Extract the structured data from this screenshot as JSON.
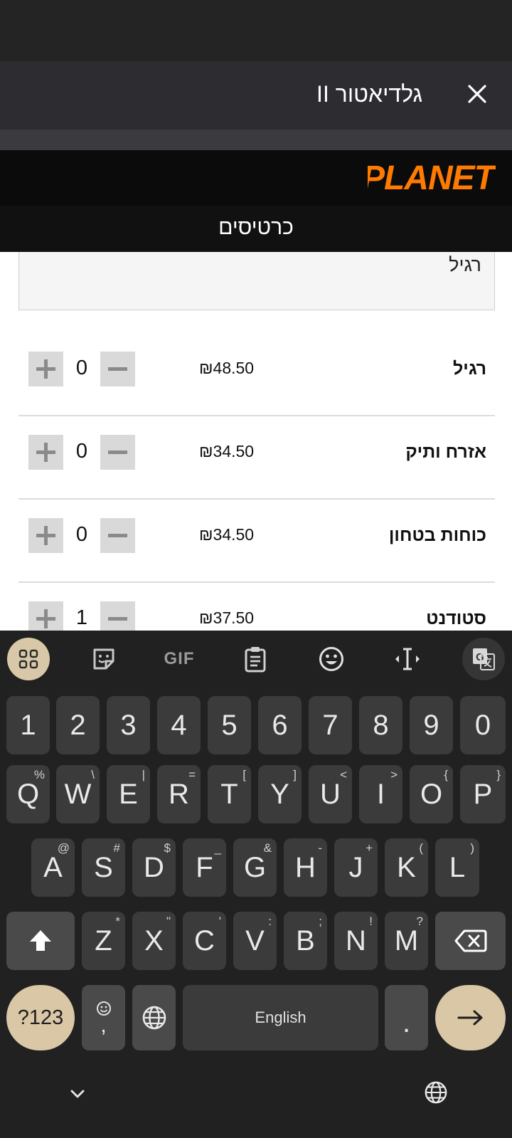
{
  "app_bar": {
    "title": "גלדיאטור II"
  },
  "brand": {
    "logo_text": "PLANET",
    "logo_color": "#ff7a00"
  },
  "section": {
    "title": "כרטיסים"
  },
  "ticket_type_select": {
    "value": "רגיל"
  },
  "tickets": [
    {
      "name": "רגיל",
      "price": "₪48.50",
      "qty": "0"
    },
    {
      "name": "אזרח ותיק",
      "price": "₪34.50",
      "qty": "0"
    },
    {
      "name": "כוחות בטחון",
      "price": "₪34.50",
      "qty": "0"
    },
    {
      "name": "סטודנט",
      "price": "₪37.50",
      "qty": "1"
    }
  ],
  "keyboard": {
    "toolbar": [
      "apps",
      "sticker",
      "GIF",
      "clipboard",
      "emoji",
      "text-cursor",
      "translate"
    ],
    "gif_label": "GIF",
    "number_row": [
      "1",
      "2",
      "3",
      "4",
      "5",
      "6",
      "7",
      "8",
      "9",
      "0"
    ],
    "row1": [
      {
        "key": "Q",
        "hint": "%"
      },
      {
        "key": "W",
        "hint": "\\"
      },
      {
        "key": "E",
        "hint": "|"
      },
      {
        "key": "R",
        "hint": "="
      },
      {
        "key": "T",
        "hint": "["
      },
      {
        "key": "Y",
        "hint": "]"
      },
      {
        "key": "U",
        "hint": "<"
      },
      {
        "key": "I",
        "hint": ">"
      },
      {
        "key": "O",
        "hint": "{"
      },
      {
        "key": "P",
        "hint": "}"
      }
    ],
    "row2": [
      {
        "key": "A",
        "hint": "@"
      },
      {
        "key": "S",
        "hint": "#"
      },
      {
        "key": "D",
        "hint": "$"
      },
      {
        "key": "F",
        "hint": "_"
      },
      {
        "key": "G",
        "hint": "&"
      },
      {
        "key": "H",
        "hint": "-"
      },
      {
        "key": "J",
        "hint": "+"
      },
      {
        "key": "K",
        "hint": "("
      },
      {
        "key": "L",
        "hint": ")"
      }
    ],
    "row3": [
      {
        "key": "Z",
        "hint": "*"
      },
      {
        "key": "X",
        "hint": "\""
      },
      {
        "key": "C",
        "hint": "'"
      },
      {
        "key": "V",
        "hint": ":"
      },
      {
        "key": "B",
        "hint": ";"
      },
      {
        "key": "N",
        "hint": "!"
      },
      {
        "key": "M",
        "hint": "?"
      }
    ],
    "symbols_label": "?123",
    "emoji_comma": ",",
    "space_label": "English",
    "period_label": "."
  }
}
